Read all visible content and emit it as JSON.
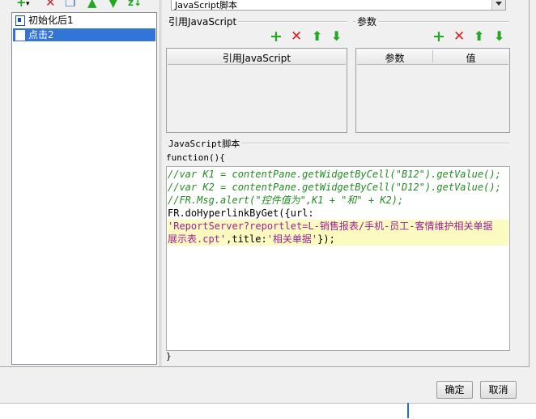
{
  "left_list": {
    "items": [
      {
        "label": "初始化后1",
        "selected": false
      },
      {
        "label": "点击2",
        "selected": true
      }
    ]
  },
  "combo": {
    "value": "JavaScript脚本"
  },
  "ref_group": {
    "title": "引用JavaScript",
    "column": "引用JavaScript"
  },
  "param_group": {
    "title": "参数",
    "columns": [
      "参数",
      "值"
    ]
  },
  "script_group": {
    "title": "JavaScript脚本",
    "header": "function(){",
    "footer": "}"
  },
  "code_lines": [
    {
      "text": "//var K1 = contentPane.getWidgetByCell(\"B12\").getValue();",
      "kind": "comment"
    },
    {
      "text": "//var K2 = contentPane.getWidgetByCell(\"D12\").getValue();",
      "kind": "comment"
    },
    {
      "text": "//FR.Msg.alert(\"控件值为\",K1 + \"和\" + K2);",
      "kind": "comment"
    },
    {
      "text": "FR.doHyperlinkByGet({url:",
      "kind": "plain"
    },
    {
      "text": "'ReportServer?reportlet=L-销售报表/手机-员工-客情维护相关单据",
      "kind": "string"
    },
    {
      "text_str": "展示表.cpt'",
      "text_plain": ",title:",
      "text_str2": "'相关单据'",
      "text_end": "});",
      "kind": "mixed"
    }
  ],
  "buttons": {
    "ok": "确定",
    "cancel": "取消"
  },
  "colors": {
    "selection": "#3375d6",
    "comment": "#238b23",
    "string": "#a01e9a",
    "highlight": "#fbfbbf"
  },
  "icons": [
    "add-icon",
    "delete-icon",
    "copy-icon",
    "move-up-icon",
    "move-down-icon",
    "sort-icon"
  ]
}
